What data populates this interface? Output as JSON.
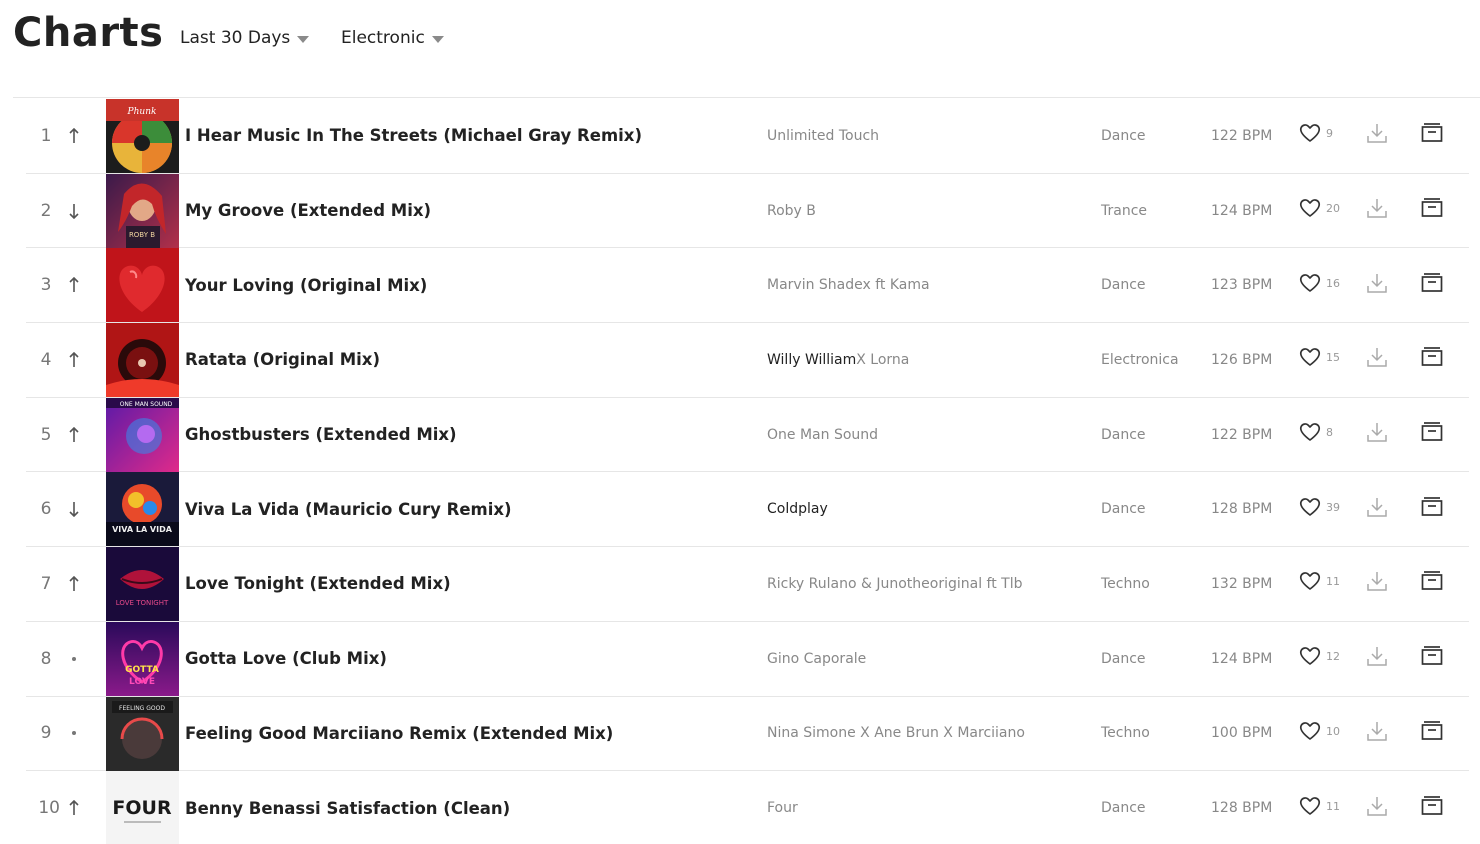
{
  "header": {
    "title": "Charts",
    "period_filter": "Last 30 Days",
    "genre_filter": "Electronic"
  },
  "colors": {
    "text_dark": "#222222",
    "text_muted": "#888888",
    "divider": "#e6e6e6"
  },
  "tracks": [
    {
      "rank": "1",
      "trend": "up",
      "title": "I Hear Music In The Streets (Michael Gray Remix)",
      "artist_parts": [
        {
          "text": "Unlimited Touch",
          "dark": false
        }
      ],
      "genre": "Dance",
      "bpm": "122 BPM",
      "likes": "9",
      "cover": "cover-unlimited-touch"
    },
    {
      "rank": "2",
      "trend": "down",
      "title": "My Groove (Extended Mix)",
      "artist_parts": [
        {
          "text": "Roby B",
          "dark": false
        }
      ],
      "genre": "Trance",
      "bpm": "124 BPM",
      "likes": "20",
      "cover": "cover-my-groove"
    },
    {
      "rank": "3",
      "trend": "up",
      "title": "Your Loving (Original Mix)",
      "artist_parts": [
        {
          "text": "Marvin Shadex ft Kama",
          "dark": false
        }
      ],
      "genre": "Dance",
      "bpm": "123 BPM",
      "likes": "16",
      "cover": "cover-your-loving"
    },
    {
      "rank": "4",
      "trend": "up",
      "title": "Ratata (Original Mix)",
      "artist_parts": [
        {
          "text": "Willy William",
          "dark": true
        },
        {
          "text": " X Lorna",
          "dark": false
        }
      ],
      "genre": "Electronica",
      "bpm": "126 BPM",
      "likes": "15",
      "cover": "cover-ratata"
    },
    {
      "rank": "5",
      "trend": "up",
      "title": "Ghostbusters (Extended Mix)",
      "artist_parts": [
        {
          "text": "One Man Sound",
          "dark": false
        }
      ],
      "genre": "Dance",
      "bpm": "122 BPM",
      "likes": "8",
      "cover": "cover-ghostbusters"
    },
    {
      "rank": "6",
      "trend": "down",
      "title": "Viva La Vida (Mauricio Cury Remix)",
      "artist_parts": [
        {
          "text": "Coldplay",
          "dark": true
        }
      ],
      "genre": "Dance",
      "bpm": "128 BPM",
      "likes": "39",
      "cover": "cover-viva-la-vida"
    },
    {
      "rank": "7",
      "trend": "up",
      "title": "Love Tonight (Extended Mix)",
      "artist_parts": [
        {
          "text": "Ricky Rulano & Junotheoriginal ft Tlb",
          "dark": false
        }
      ],
      "genre": "Techno",
      "bpm": "132 BPM",
      "likes": "11",
      "cover": "cover-love-tonight"
    },
    {
      "rank": "8",
      "trend": "same",
      "title": "Gotta Love (Club Mix)",
      "artist_parts": [
        {
          "text": "Gino Caporale",
          "dark": false
        }
      ],
      "genre": "Dance",
      "bpm": "124 BPM",
      "likes": "12",
      "cover": "cover-gotta-love"
    },
    {
      "rank": "9",
      "trend": "same",
      "title": "Feeling Good Marciiano Remix (Extended Mix)",
      "artist_parts": [
        {
          "text": "Nina Simone X Ane Brun X Marciiano",
          "dark": false
        }
      ],
      "genre": "Techno",
      "bpm": "100 BPM",
      "likes": "10",
      "cover": "cover-feeling-good"
    },
    {
      "rank": "10",
      "trend": "up",
      "title": "Benny Benassi Satisfaction (Clean)",
      "artist_parts": [
        {
          "text": "Four",
          "dark": false
        }
      ],
      "genre": "Dance",
      "bpm": "128 BPM",
      "likes": "11",
      "cover": "cover-four",
      "cover_text": "FOUR"
    }
  ]
}
